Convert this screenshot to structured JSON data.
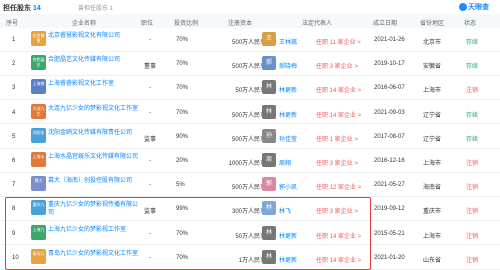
{
  "header": {
    "title": "担任股东",
    "count": "14",
    "sub": "曾担任股东 1",
    "brand": "天眼查"
  },
  "columns": {
    "no": "序号",
    "name": "企业名称",
    "pos": "职位",
    "ratio": "投资比例",
    "capital": "注册资本",
    "rep": "法定代表人",
    "date": "成立日期",
    "prov": "省份地区",
    "status": "状态"
  },
  "rows": [
    {
      "no": "1",
      "logo": "北京睿慧",
      "logo_color": "#e9a142",
      "name": "北京睿慧影视文化有限公司",
      "pos": "-",
      "ratio": "70%",
      "capital": "500万人民币",
      "av": "王",
      "av_color": "#d6a04a",
      "rep": "王林嵩",
      "role": "任职 11 家企业 >",
      "date": "2021-01-26",
      "prov": "北京市",
      "status": "存续",
      "status_type": "ok"
    },
    {
      "no": "2",
      "logo": "合肥晶艺",
      "logo_color": "#3aa86b",
      "name": "合肥晶艺文化传媒有限公司",
      "pos": "董事",
      "ratio": "70%",
      "capital": "500万人民币",
      "av": "郝",
      "av_color": "#6b8fc7",
      "rep": "郝晓梅",
      "role": "任职 3 家企业 >",
      "date": "2019-10-17",
      "prov": "安徽省",
      "status": "存续",
      "status_type": "ok"
    },
    {
      "no": "3",
      "logo": "上海睿",
      "logo_color": "#5b7fc9",
      "name": "上海睿睿影视文化工作室",
      "pos": "-",
      "ratio": "70%",
      "capital": "50万人民币",
      "av": "林",
      "av_color": "#777",
      "rep": "林更新",
      "role": "任职 14 家企业 >",
      "date": "2016-06-07",
      "prov": "上海市",
      "status": "注销",
      "status_type": "no"
    },
    {
      "no": "4",
      "logo": "大连九亿",
      "logo_color": "#e07a3a",
      "name": "大连九亿少女的梦影视文化工作室",
      "pos": "-",
      "ratio": "70%",
      "capital": "500万人民币",
      "av": "林",
      "av_color": "#777",
      "rep": "林更新",
      "role": "任职 14 家企业 >",
      "date": "2021-09-03",
      "prov": "辽宁省",
      "status": "存续",
      "status_type": "ok"
    },
    {
      "no": "5",
      "logo": "沈阳金",
      "logo_color": "#4aa0d8",
      "name": "沈阳金鸥文化传媒有限责任公司",
      "pos": "监事",
      "ratio": "90%",
      "capital": "500万人民币",
      "av": "孙",
      "av_color": "#888",
      "rep": "孙佳莹",
      "role": "任职 1 家企业 >",
      "date": "2017-08-07",
      "prov": "辽宁省",
      "status": "存续",
      "status_type": "ok"
    },
    {
      "no": "6",
      "logo": "上海水",
      "logo_color": "#e07a3a",
      "name": "上海水晶宫娱乐文化传媒有限公司",
      "pos": "-",
      "ratio": "20%",
      "capital": "1000万人民币",
      "av": "周",
      "av_color": "#777",
      "rep": "周翔",
      "role": "任职 3 家企业 >",
      "date": "2016-12-16",
      "prov": "上海市",
      "status": "注销",
      "status_type": "no"
    },
    {
      "no": "7",
      "logo": "慕大",
      "logo_color": "#7a8fc9",
      "name": "慕大（海南）创投控股有限公司",
      "pos": "-",
      "ratio": "5%",
      "capital": "500万人民币",
      "av": "郭",
      "av_color": "#d88aa0",
      "rep": "郭小凯",
      "role": "任职 12 家企业 >",
      "date": "2021-05-27",
      "prov": "海南省",
      "status": "注销",
      "status_type": "no"
    },
    {
      "no": "8",
      "logo": "重庆九",
      "logo_color": "#4aa0d8",
      "name": "重庆九亿少女的梦影视传播有限公司",
      "pos": "监事",
      "ratio": "99%",
      "capital": "300万人民币",
      "av": "林",
      "av_color": "#7fa8d8",
      "rep": "林飞",
      "role": "任职 3 家企业 >",
      "date": "2019-09-12",
      "prov": "重庆市",
      "status": "注销",
      "status_type": "no"
    },
    {
      "no": "9",
      "logo": "上海九",
      "logo_color": "#3aa86b",
      "name": "上海九亿少女的梦影视工作室",
      "pos": "-",
      "ratio": "70%",
      "capital": "50万人民币",
      "av": "林",
      "av_color": "#777",
      "rep": "林更新",
      "role": "任职 14 家企业 >",
      "date": "2015-05-21",
      "prov": "上海市",
      "status": "注销",
      "status_type": "no"
    },
    {
      "no": "10",
      "logo": "青岛九",
      "logo_color": "#e9a142",
      "name": "青岛九亿少女的梦影视文化工作室",
      "pos": "-",
      "ratio": "70%",
      "capital": "1万人民币",
      "av": "林",
      "av_color": "#777",
      "rep": "林更新",
      "role": "任职 14 家企业 >",
      "date": "2021-01-20",
      "prov": "山东省",
      "status": "注销",
      "status_type": "no"
    }
  ]
}
